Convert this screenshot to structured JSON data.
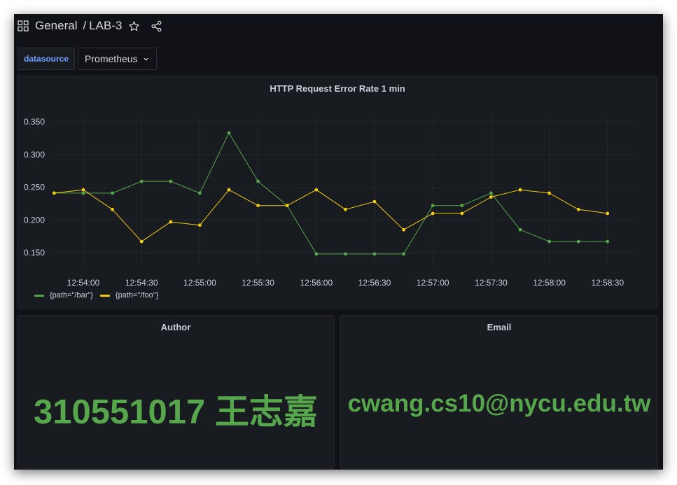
{
  "header": {
    "folder": "General",
    "separator": "/",
    "dashboard": "LAB-3"
  },
  "variables": {
    "label": "datasource",
    "value": "Prometheus"
  },
  "graph_panel": {
    "title": "HTTP Request Error Rate 1 min"
  },
  "chart_data": {
    "type": "line",
    "title": "HTTP Request Error Rate 1 min",
    "xlabel": "",
    "ylabel": "",
    "ylim": [
      0.13,
      0.36
    ],
    "yticks": [
      "0.350",
      "0.300",
      "0.250",
      "0.200",
      "0.150"
    ],
    "ytick_values": [
      0.35,
      0.3,
      0.25,
      0.2,
      0.15
    ],
    "xticks": [
      "12:54:00",
      "12:54:30",
      "12:55:00",
      "12:55:30",
      "12:56:00",
      "12:56:30",
      "12:57:00",
      "12:57:30",
      "12:58:00",
      "12:58:30"
    ],
    "x": [
      "12:53:45",
      "12:54:00",
      "12:54:15",
      "12:54:30",
      "12:54:45",
      "12:55:00",
      "12:55:15",
      "12:55:30",
      "12:55:45",
      "12:56:00",
      "12:56:15",
      "12:56:30",
      "12:56:45",
      "12:57:00",
      "12:57:15",
      "12:57:30",
      "12:57:45",
      "12:58:00",
      "12:58:15",
      "12:58:30"
    ],
    "grid": true,
    "legend_position": "bottom-left",
    "series": [
      {
        "name": "{path=\"/bar\"}",
        "color": "#56a64b",
        "values": [
          0.241,
          0.241,
          0.241,
          0.259,
          0.259,
          0.241,
          0.333,
          0.259,
          0.222,
          0.148,
          0.148,
          0.148,
          0.148,
          0.222,
          0.222,
          0.241,
          0.185,
          0.167,
          0.167,
          0.167
        ]
      },
      {
        "name": "{path=\"/foo\"}",
        "color": "#f2cc0c",
        "values": [
          0.241,
          0.246,
          0.216,
          0.167,
          0.197,
          0.192,
          0.246,
          0.222,
          0.222,
          0.246,
          0.216,
          0.228,
          0.185,
          0.21,
          0.21,
          0.235,
          0.246,
          0.241,
          0.216,
          0.21
        ]
      }
    ]
  },
  "author_panel": {
    "title": "Author",
    "value": "310551017 王志嘉"
  },
  "email_panel": {
    "title": "Email",
    "value": "cwang.cs10@nycu.edu.tw"
  },
  "icons": {
    "apps": "grid-icon",
    "star": "star-icon",
    "share": "share-icon",
    "dropdown": "chevron-down-icon"
  },
  "colors": {
    "background": "#111217",
    "panel": "#181b1f",
    "stat_green": "#56a64b",
    "variable_label": "#6e9fff"
  }
}
